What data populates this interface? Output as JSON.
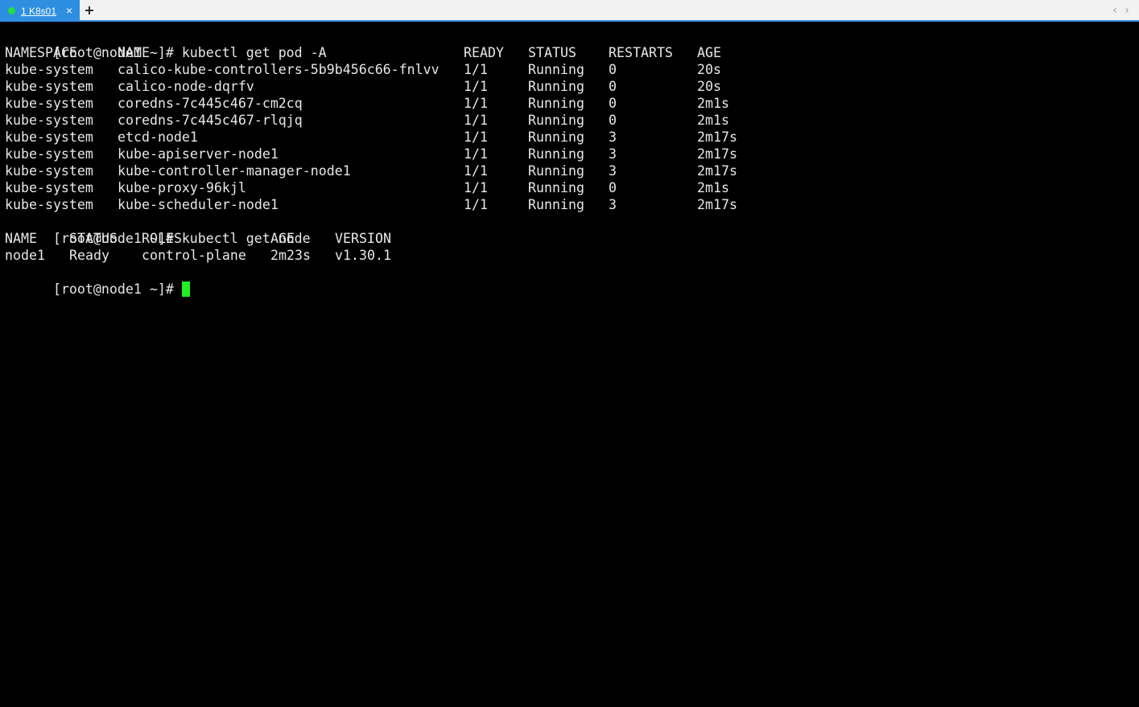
{
  "tab": {
    "number": "1",
    "title": "K8s01",
    "label": "1 K8s01",
    "close": "×",
    "status_color": "#22dd44"
  },
  "newtab_label": "+",
  "nav": {
    "prev": "‹",
    "next": "›"
  },
  "terminal": {
    "prompt": "[root@node1 ~]# ",
    "cmd1": "kubectl get pod -A",
    "pods": {
      "headers": [
        "NAMESPACE",
        "NAME",
        "READY",
        "STATUS",
        "RESTARTS",
        "AGE"
      ],
      "rows": [
        [
          "kube-system",
          "calico-kube-controllers-5b9b456c66-fnlvv",
          "1/1",
          "Running",
          "0",
          "20s"
        ],
        [
          "kube-system",
          "calico-node-dqrfv",
          "1/1",
          "Running",
          "0",
          "20s"
        ],
        [
          "kube-system",
          "coredns-7c445c467-cm2cq",
          "1/1",
          "Running",
          "0",
          "2m1s"
        ],
        [
          "kube-system",
          "coredns-7c445c467-rlqjq",
          "1/1",
          "Running",
          "0",
          "2m1s"
        ],
        [
          "kube-system",
          "etcd-node1",
          "1/1",
          "Running",
          "3",
          "2m17s"
        ],
        [
          "kube-system",
          "kube-apiserver-node1",
          "1/1",
          "Running",
          "3",
          "2m17s"
        ],
        [
          "kube-system",
          "kube-controller-manager-node1",
          "1/1",
          "Running",
          "3",
          "2m17s"
        ],
        [
          "kube-system",
          "kube-proxy-96kjl",
          "1/1",
          "Running",
          "0",
          "2m1s"
        ],
        [
          "kube-system",
          "kube-scheduler-node1",
          "1/1",
          "Running",
          "3",
          "2m17s"
        ]
      ]
    },
    "cmd2": "kubectl get node",
    "nodes": {
      "headers": [
        "NAME",
        "STATUS",
        "ROLES",
        "AGE",
        "VERSION"
      ],
      "rows": [
        [
          "node1",
          "Ready",
          "control-plane",
          "2m23s",
          "v1.30.1"
        ]
      ]
    },
    "cursor_color": "#22ee22"
  }
}
